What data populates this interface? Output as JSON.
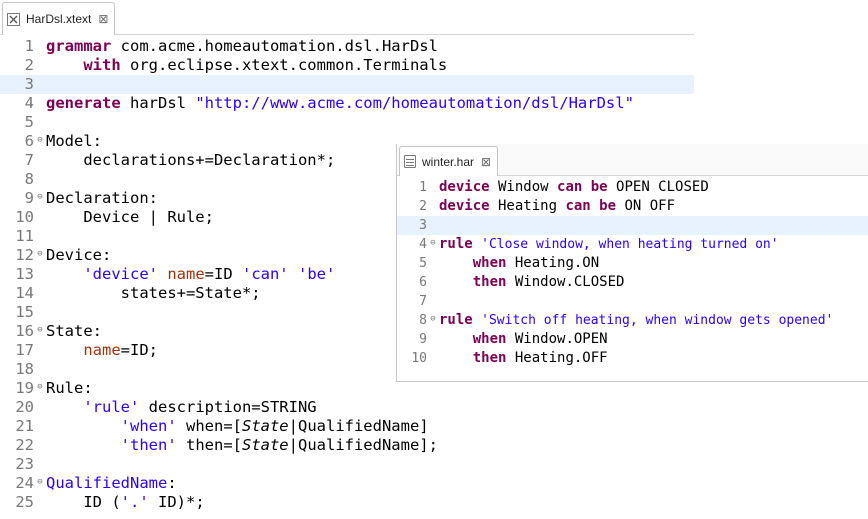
{
  "editors": [
    {
      "tab": {
        "label": "HarDsl.xtext",
        "icon": "xtext-file-icon",
        "close": "⊠"
      },
      "current_line": 2,
      "lines": [
        {
          "num": "1",
          "fold": false,
          "segs": [
            {
              "t": "grammar",
              "c": "kw"
            },
            {
              "t": " com.acme.homeautomation.dsl.HarDsl",
              "c": ""
            }
          ]
        },
        {
          "num": "2",
          "fold": false,
          "segs": [
            {
              "t": "    ",
              "c": ""
            },
            {
              "t": "with",
              "c": "kw"
            },
            {
              "t": " org.eclipse.xtext.common.Terminals",
              "c": ""
            }
          ]
        },
        {
          "num": "3",
          "fold": false,
          "segs": []
        },
        {
          "num": "4",
          "fold": false,
          "segs": [
            {
              "t": "generate",
              "c": "kw"
            },
            {
              "t": " harDsl ",
              "c": ""
            },
            {
              "t": "\"http://www.acme.com/homeautomation/dsl/HarDsl\"",
              "c": "str"
            }
          ]
        },
        {
          "num": "5",
          "fold": false,
          "segs": []
        },
        {
          "num": "6",
          "fold": true,
          "segs": [
            {
              "t": "Model:",
              "c": ""
            }
          ]
        },
        {
          "num": "7",
          "fold": false,
          "segs": [
            {
              "t": "    declarations+=Declaration*;",
              "c": ""
            }
          ]
        },
        {
          "num": "8",
          "fold": false,
          "segs": []
        },
        {
          "num": "9",
          "fold": true,
          "segs": [
            {
              "t": "Declaration:",
              "c": ""
            }
          ]
        },
        {
          "num": "10",
          "fold": false,
          "segs": [
            {
              "t": "    Device | Rule;",
              "c": ""
            }
          ]
        },
        {
          "num": "11",
          "fold": false,
          "segs": []
        },
        {
          "num": "12",
          "fold": true,
          "segs": [
            {
              "t": "Device:",
              "c": ""
            }
          ]
        },
        {
          "num": "13",
          "fold": false,
          "segs": [
            {
              "t": "    ",
              "c": ""
            },
            {
              "t": "'device'",
              "c": "str"
            },
            {
              "t": " ",
              "c": ""
            },
            {
              "t": "name",
              "c": "feat"
            },
            {
              "t": "=ID ",
              "c": ""
            },
            {
              "t": "'can'",
              "c": "str"
            },
            {
              "t": " ",
              "c": ""
            },
            {
              "t": "'be'",
              "c": "str"
            }
          ]
        },
        {
          "num": "14",
          "fold": false,
          "segs": [
            {
              "t": "        states+=State*;",
              "c": ""
            }
          ]
        },
        {
          "num": "15",
          "fold": false,
          "segs": []
        },
        {
          "num": "16",
          "fold": true,
          "segs": [
            {
              "t": "State:",
              "c": ""
            }
          ]
        },
        {
          "num": "17",
          "fold": false,
          "segs": [
            {
              "t": "    ",
              "c": ""
            },
            {
              "t": "name",
              "c": "feat"
            },
            {
              "t": "=ID;",
              "c": ""
            }
          ]
        },
        {
          "num": "18",
          "fold": false,
          "segs": []
        },
        {
          "num": "19",
          "fold": true,
          "segs": [
            {
              "t": "Rule:",
              "c": ""
            }
          ]
        },
        {
          "num": "20",
          "fold": false,
          "segs": [
            {
              "t": "    ",
              "c": ""
            },
            {
              "t": "'rule'",
              "c": "str"
            },
            {
              "t": " description=STRING",
              "c": ""
            }
          ]
        },
        {
          "num": "21",
          "fold": false,
          "segs": [
            {
              "t": "        ",
              "c": ""
            },
            {
              "t": "'when'",
              "c": "str"
            },
            {
              "t": " when=[",
              "c": ""
            },
            {
              "t": "State",
              "c": "it"
            },
            {
              "t": "|QualifiedName]",
              "c": ""
            }
          ]
        },
        {
          "num": "22",
          "fold": false,
          "segs": [
            {
              "t": "        ",
              "c": ""
            },
            {
              "t": "'then'",
              "c": "str"
            },
            {
              "t": " then=[",
              "c": ""
            },
            {
              "t": "State",
              "c": "it"
            },
            {
              "t": "|QualifiedName];",
              "c": ""
            }
          ]
        },
        {
          "num": "23",
          "fold": false,
          "segs": []
        },
        {
          "num": "24",
          "fold": true,
          "segs": [
            {
              "t": "QualifiedName",
              "c": "rname"
            },
            {
              "t": ":",
              "c": ""
            }
          ]
        },
        {
          "num": "25",
          "fold": false,
          "segs": [
            {
              "t": "    ID (",
              "c": ""
            },
            {
              "t": "'.'",
              "c": "str"
            },
            {
              "t": " ID)*;",
              "c": ""
            }
          ]
        }
      ]
    },
    {
      "tab": {
        "label": "winter.har",
        "icon": "text-file-icon",
        "close": "⊠"
      },
      "current_line": 2,
      "lines": [
        {
          "num": "1",
          "fold": false,
          "segs": [
            {
              "t": "device",
              "c": "kw"
            },
            {
              "t": " Window ",
              "c": ""
            },
            {
              "t": "can",
              "c": "kw"
            },
            {
              "t": " ",
              "c": ""
            },
            {
              "t": "be",
              "c": "kw"
            },
            {
              "t": " OPEN CLOSED",
              "c": ""
            }
          ]
        },
        {
          "num": "2",
          "fold": false,
          "segs": [
            {
              "t": "device",
              "c": "kw"
            },
            {
              "t": " Heating ",
              "c": ""
            },
            {
              "t": "can",
              "c": "kw"
            },
            {
              "t": " ",
              "c": ""
            },
            {
              "t": "be",
              "c": "kw"
            },
            {
              "t": " ON OFF",
              "c": ""
            }
          ]
        },
        {
          "num": "3",
          "fold": false,
          "segs": []
        },
        {
          "num": "4",
          "fold": true,
          "segs": [
            {
              "t": "rule",
              "c": "kw"
            },
            {
              "t": " ",
              "c": ""
            },
            {
              "t": "'Close window, when heating turned on'",
              "c": "str"
            }
          ]
        },
        {
          "num": "5",
          "fold": false,
          "segs": [
            {
              "t": "    ",
              "c": ""
            },
            {
              "t": "when",
              "c": "kw"
            },
            {
              "t": " Heating.ON",
              "c": ""
            }
          ]
        },
        {
          "num": "6",
          "fold": false,
          "segs": [
            {
              "t": "    ",
              "c": ""
            },
            {
              "t": "then",
              "c": "kw"
            },
            {
              "t": " Window.CLOSED",
              "c": ""
            }
          ]
        },
        {
          "num": "7",
          "fold": false,
          "segs": []
        },
        {
          "num": "8",
          "fold": true,
          "segs": [
            {
              "t": "rule",
              "c": "kw"
            },
            {
              "t": " ",
              "c": ""
            },
            {
              "t": "'Switch off heating, when window gets opened'",
              "c": "str"
            }
          ]
        },
        {
          "num": "9",
          "fold": false,
          "segs": [
            {
              "t": "    ",
              "c": ""
            },
            {
              "t": "when",
              "c": "kw"
            },
            {
              "t": " Window.OPEN",
              "c": ""
            }
          ]
        },
        {
          "num": "10",
          "fold": false,
          "segs": [
            {
              "t": "    ",
              "c": ""
            },
            {
              "t": "then",
              "c": "kw"
            },
            {
              "t": " Heating.OFF",
              "c": ""
            }
          ]
        }
      ]
    }
  ],
  "colors": {
    "keyword": "#7f0055",
    "string": "#2a00ff",
    "feature": "#a0320a",
    "line_number": "#787878",
    "current_line_bg": "#e8f2fe"
  }
}
